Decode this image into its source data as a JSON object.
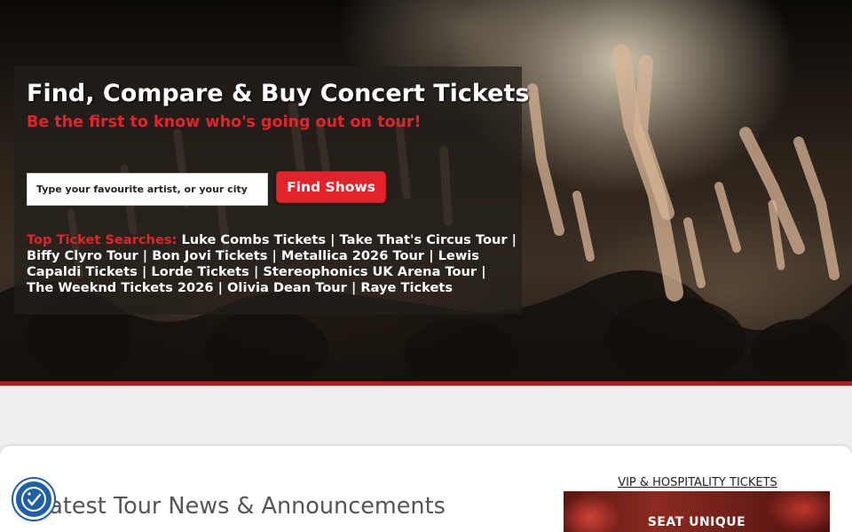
{
  "hero": {
    "title": "Find, Compare & Buy Concert Tickets",
    "subtitle": "Be the first to know who's going out on tour!",
    "search": {
      "placeholder": "Type your favourite artist, or your city",
      "value": ""
    },
    "find_button_label": "Find Shows",
    "top_searches": {
      "label": "Top Ticket Searches:",
      "separator": "|",
      "links": [
        "Luke Combs Tickets",
        "Take That's Circus Tour",
        "Biffy Clyro Tour",
        "Bon Jovi Tickets",
        "Metallica 2026 Tour",
        "Lewis Capaldi Tickets",
        "Lorde Tickets",
        "Stereophonics UK Arena Tour",
        "The Weeknd Tickets 2026",
        "Olivia Dean Tour",
        "Raye Tickets"
      ]
    }
  },
  "content": {
    "news_heading": "Latest Tour News & Announcements",
    "vip_link": "VIP & HOSPITALITY TICKETS",
    "vip_banner_text": "SEAT UNIQUE"
  },
  "accessibility": {
    "icon": "accessibility-icon"
  },
  "colors": {
    "accent_red": "#e2232a",
    "divider_red": "#b0191e",
    "a11y_blue": "#1f5fa8"
  }
}
